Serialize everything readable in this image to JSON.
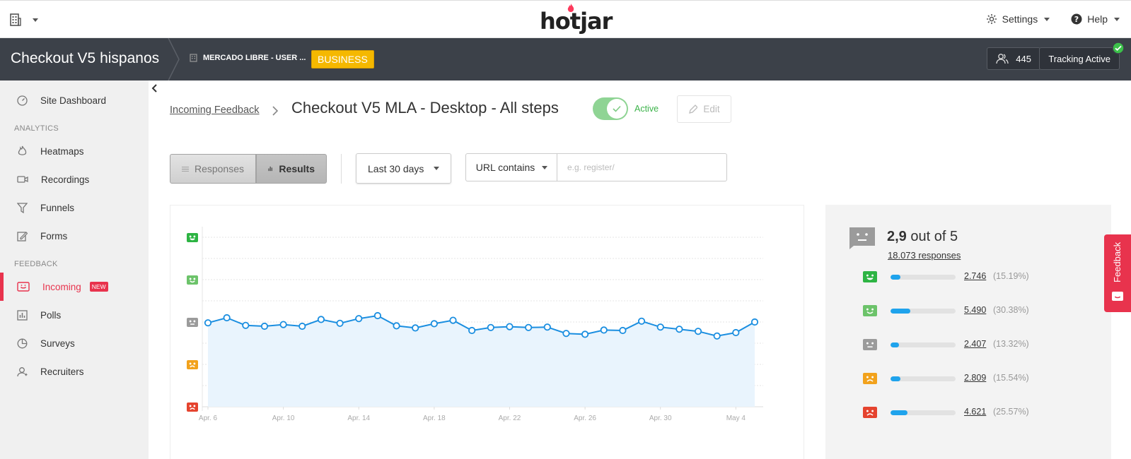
{
  "brand": {
    "logo_text": "hotjar",
    "accent": "#e8334d"
  },
  "topbar": {
    "settings_label": "Settings",
    "help_label": "Help"
  },
  "site": {
    "name": "Checkout V5 hispanos",
    "account": "MERCADO LIBRE - USER ...",
    "plan": "BUSINESS",
    "user_count": "445",
    "tracking": "Tracking Active"
  },
  "sidebar": {
    "dashboard": "Site Dashboard",
    "analytics_heading": "ANALYTICS",
    "analytics": [
      "Heatmaps",
      "Recordings",
      "Funnels",
      "Forms"
    ],
    "feedback_heading": "FEEDBACK",
    "incoming": "Incoming",
    "new_badge": "NEW",
    "feedback": [
      "Polls",
      "Surveys",
      "Recruiters"
    ]
  },
  "page": {
    "breadcrumb": "Incoming Feedback",
    "title": "Checkout V5 MLA - Desktop - All steps",
    "status": "Active",
    "edit_label": "Edit"
  },
  "filters": {
    "responses_label": "Responses",
    "results_label": "Results",
    "date_range": "Last 30 days",
    "url_mode": "URL contains",
    "url_placeholder": "e.g. register/"
  },
  "chart_data": {
    "type": "area",
    "y_scale": [
      "hate",
      "dislike",
      "neutral",
      "like",
      "love"
    ],
    "y_scores": [
      1,
      2,
      3,
      4,
      5
    ],
    "ylim": [
      1,
      5
    ],
    "x_tick_labels": [
      "Apr. 6",
      "Apr. 10",
      "Apr. 14",
      "Apr. 18",
      "Apr. 22",
      "Apr. 26",
      "Apr. 30",
      "May 4"
    ],
    "x_tick_index": [
      0,
      4,
      8,
      12,
      16,
      20,
      24,
      28
    ],
    "values": [
      2.98,
      3.1,
      2.92,
      2.9,
      2.94,
      2.9,
      3.06,
      2.97,
      3.08,
      3.15,
      2.91,
      2.86,
      2.96,
      3.04,
      2.8,
      2.87,
      2.89,
      2.87,
      2.88,
      2.73,
      2.71,
      2.81,
      2.8,
      3.02,
      2.88,
      2.83,
      2.78,
      2.67,
      2.75,
      3.0
    ],
    "line_color": "#1a8ee0",
    "fill_color": "#e9f4fd",
    "grid": true
  },
  "summary": {
    "score": "2,9",
    "score_suffix": "out of 5",
    "responses_link": "18.073 responses",
    "rows": [
      {
        "mood": "love",
        "count": "2.746",
        "pct": "(15.19%)",
        "fraction": 0.1519,
        "color": "#2db443"
      },
      {
        "mood": "like",
        "count": "5.490",
        "pct": "(30.38%)",
        "fraction": 0.3038,
        "color": "#6cc36a"
      },
      {
        "mood": "neutral",
        "count": "2.407",
        "pct": "(13.32%)",
        "fraction": 0.1332,
        "color": "#9b9b9b"
      },
      {
        "mood": "dislike",
        "count": "2.809",
        "pct": "(15.54%)",
        "fraction": 0.1554,
        "color": "#f2a21c"
      },
      {
        "mood": "hate",
        "count": "4.621",
        "pct": "(25.57%)",
        "fraction": 0.2557,
        "color": "#e5432e"
      }
    ]
  },
  "feedback_tab": {
    "label": "Feedback"
  }
}
